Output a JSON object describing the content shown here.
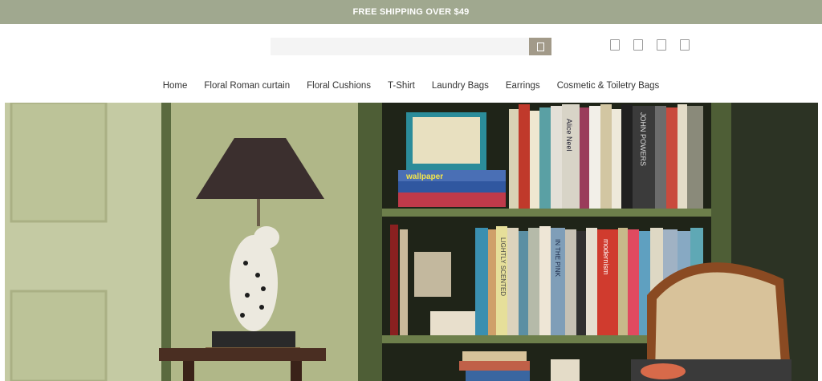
{
  "announcement": {
    "text": "FREE SHIPPING OVER $49"
  },
  "search": {
    "placeholder": "",
    "button_icon": "search-icon"
  },
  "header_icons": [
    "account-icon",
    "wishlist-icon",
    "compare-icon",
    "cart-icon"
  ],
  "nav": {
    "items": [
      {
        "label": "Home"
      },
      {
        "label": "Floral Roman curtain"
      },
      {
        "label": "Floral Cushions"
      },
      {
        "label": "T-Shirt"
      },
      {
        "label": "Laundry Bags"
      },
      {
        "label": "Earrings"
      },
      {
        "label": "Cosmetic & Toiletry Bags"
      }
    ]
  },
  "hero": {
    "book_spines": [
      "wallpaper",
      "Alice Neel",
      "JOHN POWERS",
      "modernism",
      "IN THE PINK",
      "LIGHTLY SCENTED"
    ],
    "colors": {
      "wall": "#b5bd8f",
      "shelf": "#5f6f45",
      "accent": "#c0392b"
    }
  },
  "theme": {
    "topbar_bg": "#a0a88f",
    "search_btn": "#a29a89"
  }
}
